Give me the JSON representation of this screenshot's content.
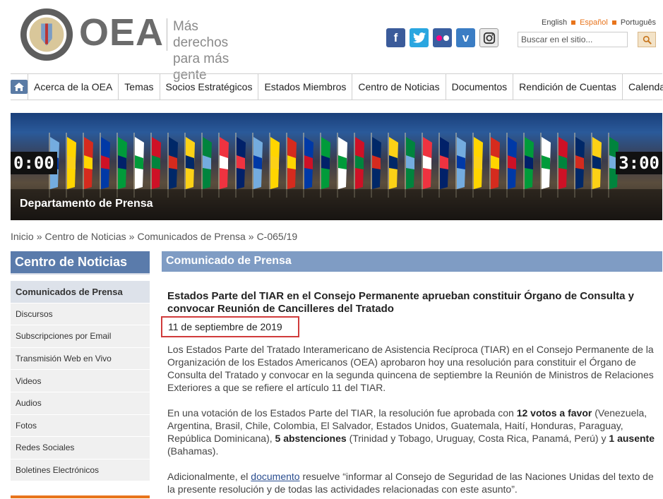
{
  "header": {
    "logo_text": "OEA",
    "tagline_line1": "Más derechos",
    "tagline_line2": "para más gente",
    "languages": [
      "English",
      "Español",
      "Português"
    ],
    "active_language": "Español",
    "search": {
      "placeholder": "Buscar en el sitio..."
    },
    "social": [
      "facebook-icon",
      "twitter-icon",
      "flickr-icon",
      "vimeo-icon",
      "instagram-icon"
    ]
  },
  "nav": {
    "items": [
      "Acerca de la OEA",
      "Temas",
      "Socios Estratégicos",
      "Estados Miembros",
      "Centro de Noticias",
      "Documentos",
      "Rendición de Cuentas",
      "Calendario"
    ]
  },
  "banner": {
    "title": "Departamento de Prensa",
    "clock_left": "0:00",
    "clock_right": "3:00"
  },
  "breadcrumb": [
    "Inicio",
    "Centro de Noticias",
    "Comunicados de Prensa",
    "C-065/19"
  ],
  "sidebar": {
    "title": "Centro de Noticias",
    "items": [
      "Comunicados de Prensa",
      "Discursos",
      "Subscripciones por Email",
      "Transmisión Web en Vivo",
      "Videos",
      "Audios",
      "Fotos",
      "Redes Sociales",
      "Boletines Electrónicos"
    ]
  },
  "main": {
    "section_title": "Comunicado de Prensa",
    "headline": "Estados Parte del TIAR en el Consejo Permanente aprueban constituir Órgano de Consulta y convocar Reunión de Cancilleres del Tratado",
    "date": "11 de septiembre de 2019",
    "p1": "Los Estados Parte del Tratado Interamericano de Asistencia Recíproca (TIAR) en el Consejo Permanente de la Organización de los Estados Americanos (OEA) aprobaron hoy una resolución para constituir el Órgano de Consulta del Tratado y convocar en la segunda quincena de septiembre la Reunión de Ministros de Relaciones Exteriores a que se refiere el artículo 11 del TIAR.",
    "p2_a": "En una votación de los Estados Parte del TIAR, la resolución fue aprobada con ",
    "p2_b": "12 votos a favor",
    "p2_c": " (Venezuela, Argentina, Brasil, Chile, Colombia, El Salvador, Estados Unidos, Guatemala, Haití, Honduras, Paraguay, República Dominicana), ",
    "p2_d": "5 abstenciones",
    "p2_e": " (Trinidad y Tobago, Uruguay, Costa Rica, Panamá, Perú) y ",
    "p2_f": "1 ausente",
    "p2_g": " (Bahamas).",
    "p3_a": "Adicionalmente, el ",
    "p3_link": "documento",
    "p3_b": " resuelve “informar al Consejo de Seguridad de las Naciones Unidas del texto de la presente resolución y de todas las actividades relacionadas con este asunto”."
  },
  "colors": {
    "accent_orange": "#e8741c",
    "sidebar_blue": "#5a7bab",
    "section_blue": "#7f9cc4",
    "date_highlight": "#d03b3b"
  }
}
